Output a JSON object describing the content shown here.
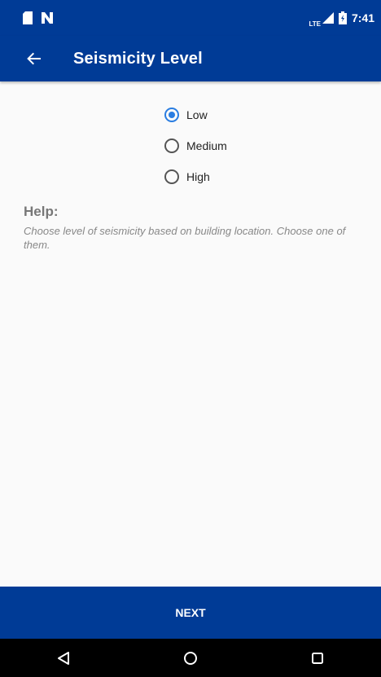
{
  "status_bar": {
    "time": "7:41",
    "network": "LTE",
    "icons_left": [
      "sd-card-icon",
      "nfc-icon"
    ],
    "icons_right": [
      "signal-icon",
      "battery-icon"
    ]
  },
  "app_bar": {
    "title": "Seismicity Level",
    "back_icon": "arrow-left-icon"
  },
  "options": [
    {
      "label": "Low",
      "selected": true
    },
    {
      "label": "Medium",
      "selected": false
    },
    {
      "label": "High",
      "selected": false
    }
  ],
  "help": {
    "title": "Help:",
    "text": "Choose level of seismicity based on building location. Choose one of them."
  },
  "footer": {
    "next_label": "NEXT"
  },
  "nav_bar": {
    "buttons": [
      "back-triangle-icon",
      "home-circle-icon",
      "recents-square-icon"
    ]
  },
  "colors": {
    "primary": "#003b96",
    "accent": "#2a7de1",
    "background": "#fafafa"
  }
}
